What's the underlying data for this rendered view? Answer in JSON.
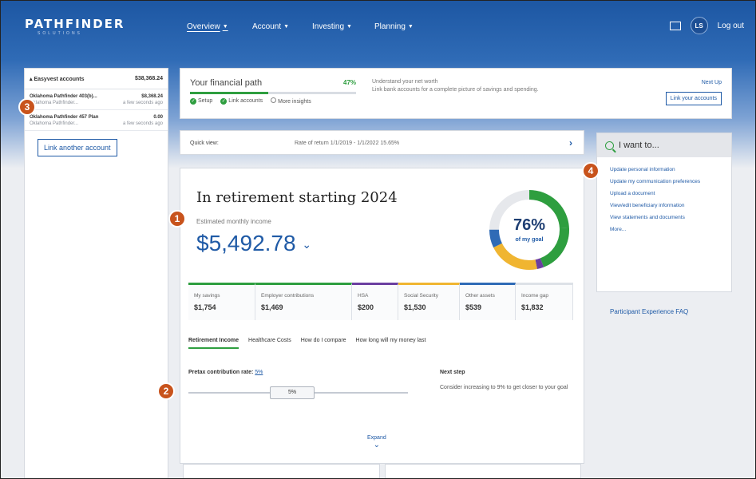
{
  "header": {
    "logo": "PATHFINDER",
    "logo_sub": "SOLUTIONS",
    "nav": [
      {
        "label": "Overview"
      },
      {
        "label": "Account"
      },
      {
        "label": "Investing"
      },
      {
        "label": "Planning"
      }
    ],
    "avatar_initials": "LS",
    "logout": "Log out"
  },
  "accounts": {
    "header_label": "Easyvest accounts",
    "header_total": "$38,368.24",
    "rows": [
      {
        "name": "Oklahoma Pathfinder 403(b)...",
        "value": "$8,368.24",
        "sub": "Oklahoma Pathfinder...",
        "time": "a few seconds ago"
      },
      {
        "name": "Oklahoma Pathfinder 457 Plan",
        "value": "0.00",
        "sub": "Oklahoma Pathfinder...",
        "time": "a few seconds ago"
      }
    ],
    "link_button": "Link another account"
  },
  "financial_path": {
    "title": "Your financial path",
    "percent": "47%",
    "progress": 0.47,
    "steps": [
      "Setup",
      "Link accounts",
      "More insights"
    ],
    "desc1": "Understand your net worth",
    "desc2": "Link bank accounts for a complete picture of savings and spending.",
    "next_up": "Next Up",
    "button": "Link your accounts"
  },
  "quick_view": {
    "label": "Quick view:",
    "rate": "Rate of return  1/1/2019 - 1/1/2022  15.65%"
  },
  "retirement": {
    "title": "In retirement starting 2024",
    "est_label": "Estimated monthly income",
    "est_value": "$5,492.78",
    "goal_pct": "76%",
    "goal_label": "of my goal",
    "goal_fraction": 0.76,
    "savings": [
      {
        "label": "My savings",
        "value": "$1,754",
        "color": "#2e9e3f"
      },
      {
        "label": "Employer contributions",
        "value": "$1,469",
        "color": "#2e9e3f"
      },
      {
        "label": "HSA",
        "value": "$200",
        "color": "#6b3fa0"
      },
      {
        "label": "Social Security",
        "value": "$1,530",
        "color": "#f0b531"
      },
      {
        "label": "Other assets",
        "value": "$539",
        "color": "#2f6bb6"
      },
      {
        "label": "Income gap",
        "value": "$1,832",
        "color": "#dde1e7"
      }
    ],
    "tabs": [
      "Retirement Income",
      "Healthcare Costs",
      "How do I compare",
      "How long will my money last"
    ],
    "pretax_label": "Pretax contribution rate:",
    "pretax_value": "5%",
    "slider_value": "5%",
    "next_step_title": "Next step",
    "next_step_desc": "Consider increasing to 9% to get closer to your goal",
    "expand": "Expand"
  },
  "i_want_to": {
    "title": "I want to...",
    "links": [
      "Update personal information",
      "Update my communication preferences",
      "Upload a document",
      "View/edit beneficiary information",
      "View statements and documents",
      "More..."
    ]
  },
  "faq": "Participant Experience FAQ",
  "badges": [
    "1",
    "2",
    "3",
    "4"
  ]
}
